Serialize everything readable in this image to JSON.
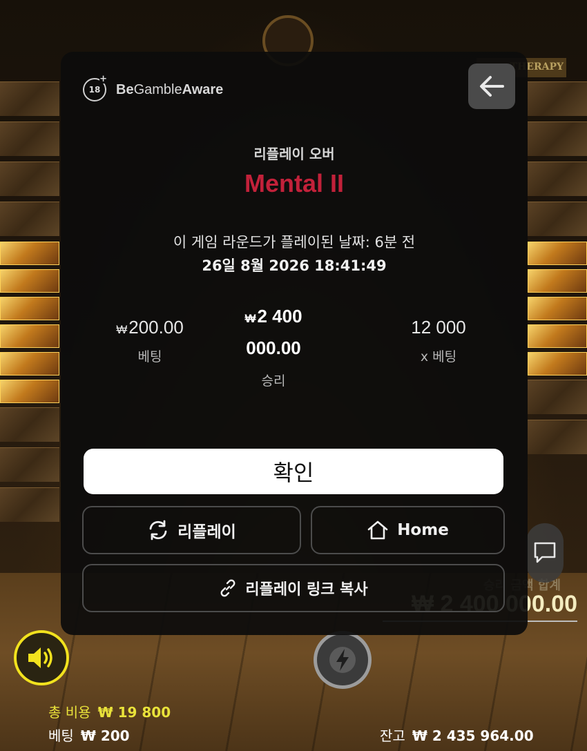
{
  "background": {
    "therapy_tag": "THERAPY",
    "win_total_label": "승리 금액 합계",
    "win_total_value": "₩ 2 400 000.00",
    "total_cost_label": "총 비용",
    "total_cost_value": "₩ 19 800",
    "bet_label": "베팅",
    "bet_value": "₩ 200",
    "balance_label": "잔고",
    "balance_value": "₩ 2 435 964.00"
  },
  "modal": {
    "age_badge": "18",
    "brand_bold_1": "Be",
    "brand_regular": "Gamble",
    "brand_bold_2": "Aware",
    "replay_over": "리플레이 오버",
    "game_title": "Mental II",
    "played_text": "이 게임 라운드가 플레이된 날짜: 6분 전",
    "date_text": "26일 8월 2026 18:41:49",
    "bet": {
      "currency": "₩",
      "value": "200.00",
      "label": "베팅"
    },
    "win": {
      "currency": "₩",
      "value_line1": "2 400",
      "value_line2": "000.00",
      "label": "승리"
    },
    "multiplier": {
      "value": "12 000",
      "label": "x 베팅"
    },
    "confirm_label": "확인",
    "replay_label": "리플레이",
    "home_label": "Home",
    "copy_link_label": "리플레이 링크 복사"
  },
  "colors": {
    "title_red": "#c2213a",
    "sound_ring": "#f2e21e",
    "total_cost_yellow": "#e9e23a"
  },
  "icons": [
    "back-arrow-icon",
    "replay-icon",
    "home-icon",
    "link-icon",
    "sound-icon",
    "lightning-icon",
    "chat-icon"
  ]
}
